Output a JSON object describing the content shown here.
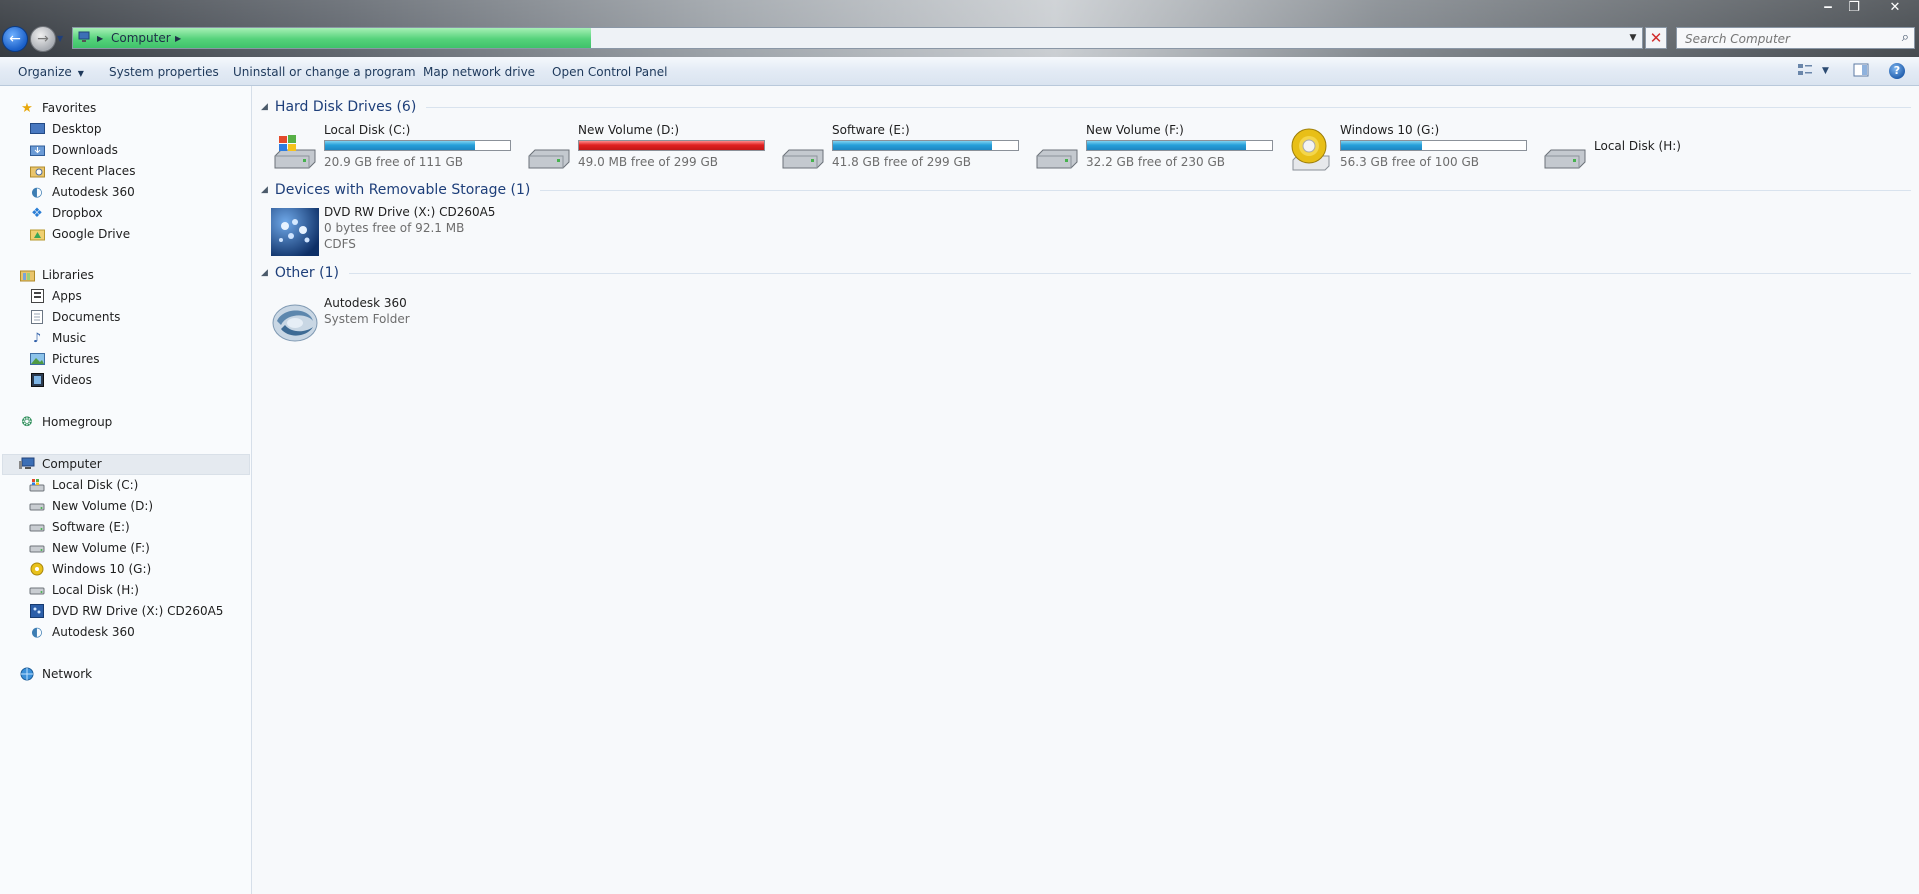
{
  "window": {
    "controls": {
      "minimize": "‒",
      "maximize": "❐",
      "close": "✕"
    }
  },
  "navigation": {
    "address_breadcrumb": [
      "Computer"
    ],
    "load_progress_percent": 33,
    "search_placeholder": "Search Computer"
  },
  "toolbar": {
    "items": [
      "Organize",
      "System properties",
      "Uninstall or change a program",
      "Map network drive",
      "Open Control Panel"
    ]
  },
  "sidebar": {
    "favorites": {
      "label": "Favorites",
      "items": [
        "Desktop",
        "Downloads",
        "Recent Places",
        "Autodesk 360",
        "Dropbox",
        "Google Drive"
      ]
    },
    "libraries": {
      "label": "Libraries",
      "items": [
        "Apps",
        "Documents",
        "Music",
        "Pictures",
        "Videos"
      ]
    },
    "homegroup": {
      "label": "Homegroup"
    },
    "computer": {
      "label": "Computer",
      "items": [
        "Local Disk (C:)",
        "New Volume (D:)",
        "Software (E:)",
        "New Volume (F:)",
        "Windows 10 (G:)",
        "Local Disk (H:)",
        "DVD RW Drive (X:) CD260A5",
        "Autodesk 360"
      ]
    },
    "network": {
      "label": "Network"
    }
  },
  "content": {
    "groups": [
      {
        "title": "Hard Disk Drives (6)",
        "drives": [
          {
            "name": "Local Disk (C:)",
            "free_text": "20.9 GB free of 111 GB",
            "used_fraction": 0.81,
            "status": "normal",
            "icon": "windows-hard-drive-icon"
          },
          {
            "name": "New Volume (D:)",
            "free_text": "49.0 MB free of 299 GB",
            "used_fraction": 1.0,
            "status": "critical",
            "icon": "hard-drive-icon"
          },
          {
            "name": "Software (E:)",
            "free_text": "41.8 GB free of 299 GB",
            "used_fraction": 0.86,
            "status": "normal",
            "icon": "hard-drive-icon"
          },
          {
            "name": "New Volume (F:)",
            "free_text": "32.2 GB free of 230 GB",
            "used_fraction": 0.86,
            "status": "normal",
            "icon": "hard-drive-icon"
          },
          {
            "name": "Windows 10 (G:)",
            "free_text": "56.3 GB free of 100 GB",
            "used_fraction": 0.44,
            "status": "normal",
            "icon": "disc-drive-icon"
          },
          {
            "name": "Local Disk (H:)",
            "free_text": "",
            "used_fraction": null,
            "status": "none",
            "icon": "hard-drive-icon"
          }
        ]
      },
      {
        "title": "Devices with Removable Storage (1)",
        "devices": [
          {
            "name": "DVD RW Drive (X:) CD260A5",
            "line1": "0 bytes free of 92.1 MB",
            "line2": "CDFS",
            "icon": "dvd-drive-icon"
          }
        ]
      },
      {
        "title": "Other (1)",
        "devices": [
          {
            "name": "Autodesk 360",
            "line1": "System Folder",
            "icon": "autodesk-360-icon"
          }
        ]
      }
    ]
  },
  "colors": {
    "bar_normal": "#26a0da",
    "bar_critical": "#e02020",
    "link_blue": "#1e3f7a",
    "progress_green": "#55d27b"
  }
}
